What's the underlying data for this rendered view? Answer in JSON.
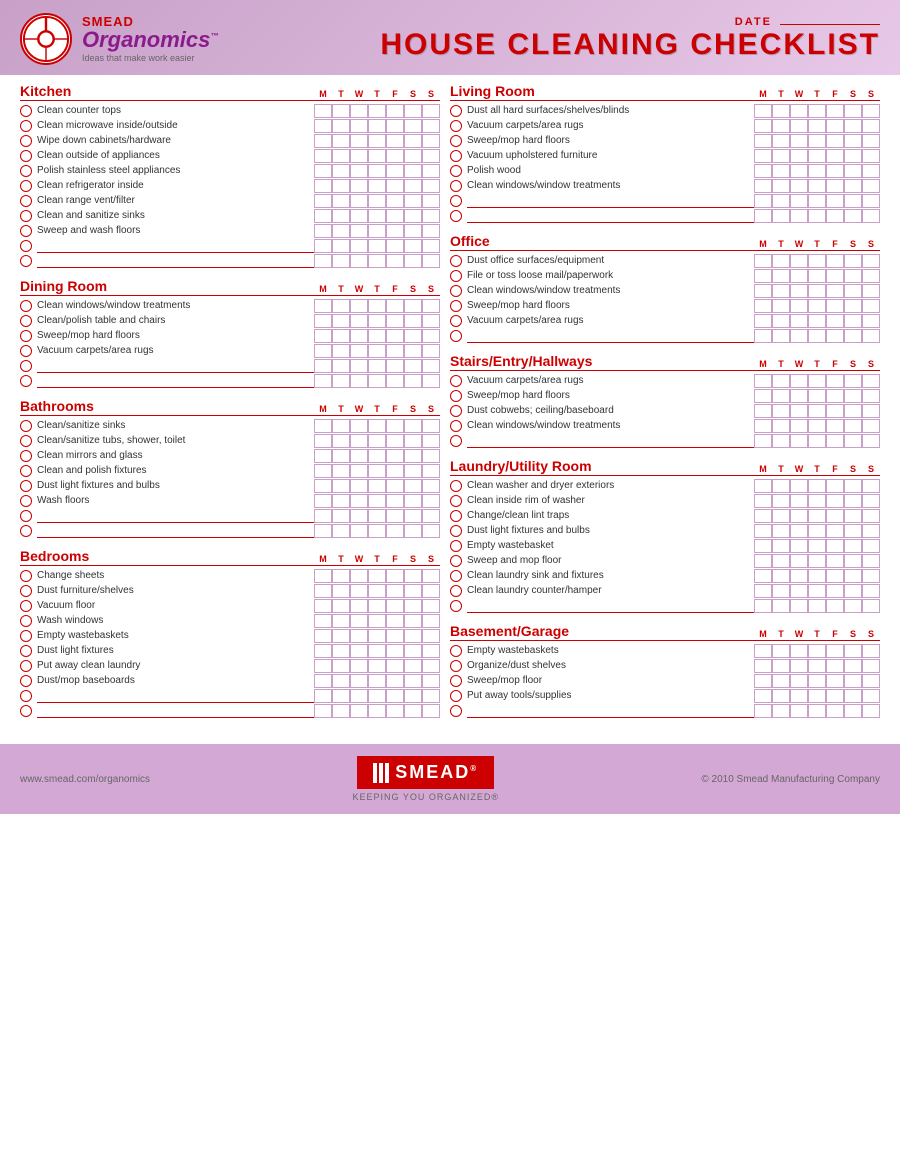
{
  "header": {
    "brand": "SMEAD",
    "brand_sub": "Organomics",
    "tagline": "Ideas that make work easier",
    "title": "HOUSE CLEANING CHECKLIST",
    "date_label": "DATE"
  },
  "days": [
    "M",
    "T",
    "W",
    "T",
    "F",
    "S",
    "S"
  ],
  "sections": {
    "kitchen": {
      "title": "Kitchen",
      "items": [
        "Clean counter tops",
        "Clean microwave inside/outside",
        "Wipe down cabinets/hardware",
        "Clean outside of appliances",
        "Polish stainless steel appliances",
        "Clean refrigerator inside",
        "Clean range vent/filter",
        "Clean and sanitize sinks",
        "Sweep and wash floors"
      ],
      "blanks": 2
    },
    "dining_room": {
      "title": "Dining Room",
      "items": [
        "Clean windows/window treatments",
        "Clean/polish table and chairs",
        "Sweep/mop hard floors",
        "Vacuum carpets/area rugs"
      ],
      "blanks": 2
    },
    "bathrooms": {
      "title": "Bathrooms",
      "items": [
        "Clean/sanitize sinks",
        "Clean/sanitize tubs, shower, toilet",
        "Clean mirrors and glass",
        "Clean and polish fixtures",
        "Dust light fixtures and bulbs",
        "Wash floors"
      ],
      "blanks": 2
    },
    "bedrooms": {
      "title": "Bedrooms",
      "items": [
        "Change sheets",
        "Dust furniture/shelves",
        "Vacuum floor",
        "Wash windows",
        "Empty wastebaskets",
        "Dust light fixtures",
        "Put away clean laundry",
        "Dust/mop baseboards"
      ],
      "blanks": 2
    },
    "living_room": {
      "title": "Living Room",
      "items": [
        "Dust all hard surfaces/shelves/blinds",
        "Vacuum carpets/area rugs",
        "Sweep/mop hard floors",
        "Vacuum upholstered furniture",
        "Polish wood",
        "Clean windows/window treatments"
      ],
      "blanks": 2
    },
    "office": {
      "title": "Office",
      "items": [
        "Dust office surfaces/equipment",
        "File or toss loose mail/paperwork",
        "Clean windows/window treatments",
        "Sweep/mop hard floors",
        "Vacuum carpets/area rugs"
      ],
      "blanks": 1
    },
    "stairs": {
      "title": "Stairs/Entry/Hallways",
      "items": [
        "Vacuum carpets/area rugs",
        "Sweep/mop hard floors",
        "Dust cobwebs; ceiling/baseboard",
        "Clean windows/window treatments"
      ],
      "blanks": 1
    },
    "laundry": {
      "title": "Laundry/Utility Room",
      "items": [
        "Clean washer and dryer exteriors",
        "Clean inside rim of washer",
        "Change/clean lint traps",
        "Dust light fixtures and bulbs",
        "Empty wastebasket",
        "Sweep and mop floor",
        "Clean laundry sink and fixtures",
        "Clean laundry counter/hamper"
      ],
      "blanks": 1
    },
    "basement": {
      "title": "Basement/Garage",
      "items": [
        "Empty wastebaskets",
        "Organize/dust shelves",
        "Sweep/mop floor",
        "Put away tools/supplies"
      ],
      "blanks": 1
    }
  },
  "footer": {
    "website": "www.smead.com/organomics",
    "brand": "SMEAD",
    "tagline": "KEEPING YOU ORGANIZED®",
    "copyright": "© 2010 Smead Manufacturing Company"
  }
}
